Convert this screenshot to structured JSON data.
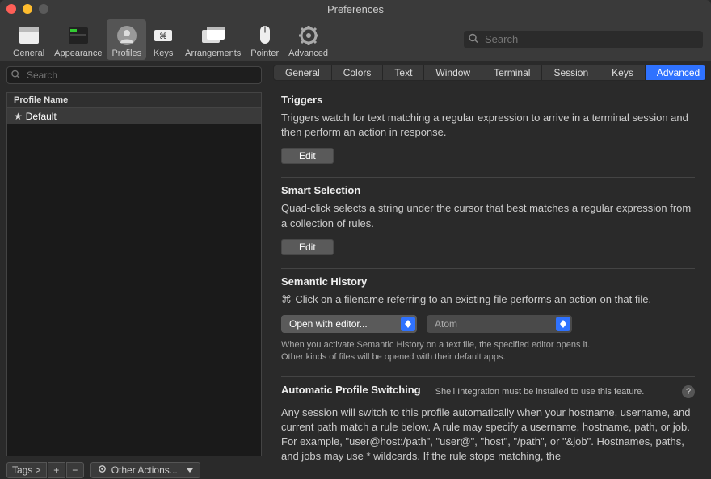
{
  "window": {
    "title": "Preferences"
  },
  "toolbar": {
    "items": [
      {
        "label": "General"
      },
      {
        "label": "Appearance"
      },
      {
        "label": "Profiles"
      },
      {
        "label": "Keys"
      },
      {
        "label": "Arrangements"
      },
      {
        "label": "Pointer"
      },
      {
        "label": "Advanced"
      }
    ],
    "search_placeholder": "Search"
  },
  "sidebar": {
    "search_placeholder": "Search",
    "header": "Profile Name",
    "profiles": [
      {
        "name": "Default",
        "starred": true
      }
    ],
    "bottom": {
      "tags_label": "Tags >",
      "plus": "+",
      "minus": "−",
      "other_actions": "Other Actions..."
    }
  },
  "tabs": [
    "General",
    "Colors",
    "Text",
    "Window",
    "Terminal",
    "Session",
    "Keys",
    "Advanced"
  ],
  "sections": {
    "triggers": {
      "title": "Triggers",
      "desc": "Triggers watch for text matching a regular expression to arrive in a terminal session and then perform an action in response.",
      "edit": "Edit"
    },
    "smart_selection": {
      "title": "Smart Selection",
      "desc": "Quad-click selects a string under the cursor that best matches a regular expression from a collection of rules.",
      "edit": "Edit"
    },
    "semantic_history": {
      "title": "Semantic History",
      "desc": "⌘-Click on a filename referring to an existing file performs an action on that file.",
      "select1": "Open with editor...",
      "select2": "Atom",
      "hint": "When you activate Semantic History on a text file, the specified editor opens it.\nOther kinds of files will be opened with their default apps."
    },
    "aps": {
      "title": "Automatic Profile Switching",
      "note": "Shell Integration must be installed to use this feature.",
      "desc": "Any session will switch to this profile automatically when your hostname, username, and current path match a rule below. A rule may specify a username, hostname, path, or job. For example, \"user@host:/path\", \"user@\", \"host\", \"/path\", or \"&job\". Hostnames, paths, and jobs may use * wildcards. If the rule stops matching, the"
    }
  }
}
